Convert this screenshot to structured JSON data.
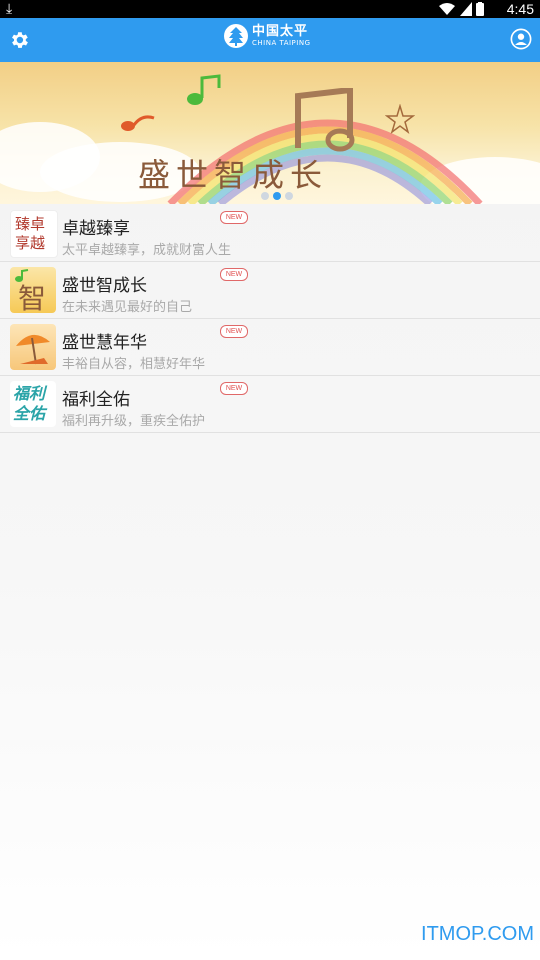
{
  "status_bar": {
    "time": "4:45"
  },
  "app_bar": {
    "logo_cn": "中国太平",
    "logo_en": "CHINA TAIPING",
    "left_icon": "gear-icon",
    "right_icon": "user-icon"
  },
  "banner": {
    "title": "盛世智成长",
    "page_count": 3,
    "active_index": 1
  },
  "products": [
    {
      "title": "卓越臻享",
      "subtitle": "太平卓越臻享，成就财富人生",
      "badge": "NEW",
      "thumb_text": "臻卓享越"
    },
    {
      "title": "盛世智成长",
      "subtitle": "在未来遇见最好的自己",
      "badge": "NEW",
      "thumb_text": "智"
    },
    {
      "title": "盛世慧年华",
      "subtitle": "丰裕自从容，相慧好年华",
      "badge": "NEW",
      "thumb_text": ""
    },
    {
      "title": "福利全佑",
      "subtitle": "福利再升级，重疾全佑护",
      "badge": "NEW",
      "thumb_text": "福利全佑"
    }
  ],
  "watermark": "ITMOP.COM",
  "colors": {
    "accent": "#2f9bef",
    "badge": "#e05050"
  }
}
